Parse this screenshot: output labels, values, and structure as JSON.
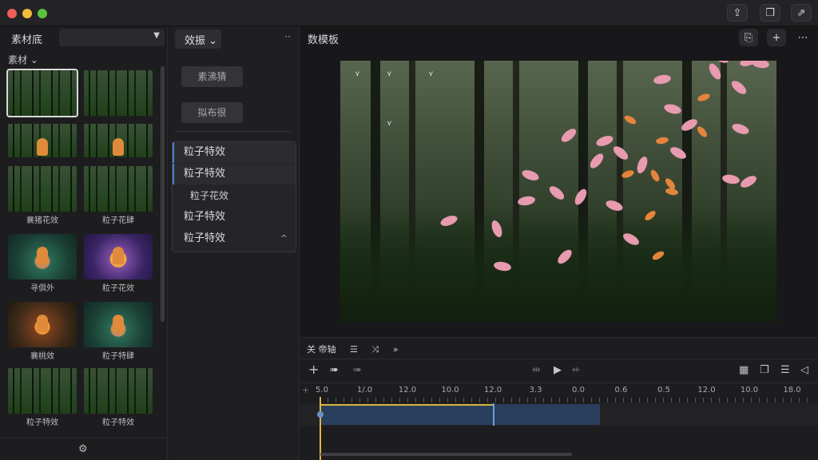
{
  "titlebar": {
    "buttons": [
      "upload-icon",
      "copy-icon",
      "share-icon"
    ]
  },
  "left_panel": {
    "title": "素材底",
    "subtitle": "素材 ⌄",
    "thumbnails": [
      {
        "label": "",
        "style": "forest",
        "selected": true
      },
      {
        "label": "",
        "style": "forest"
      },
      {
        "label": "",
        "style": "forest"
      },
      {
        "label": "",
        "style": "forest"
      },
      {
        "label": "襄猪花效",
        "style": "forest"
      },
      {
        "label": "粒子花肆",
        "style": "forest"
      },
      {
        "label": "寻俱外",
        "style": "teal"
      },
      {
        "label": "粒子花效",
        "style": "magic"
      },
      {
        "label": "襄桃效",
        "style": "warm"
      },
      {
        "label": "粒子特肆",
        "style": "teal"
      },
      {
        "label": "粒子特效",
        "style": "forest"
      },
      {
        "label": "粒子特效",
        "style": "forest"
      }
    ]
  },
  "middle_panel": {
    "tab": "效振 ⌄",
    "buttons": [
      "素沸猜",
      "拟布很"
    ],
    "menu": [
      {
        "label": "粒子特效",
        "active": true
      },
      {
        "label": "粒子特效",
        "active": true
      },
      {
        "label": "粒子花效",
        "sub": true
      },
      {
        "label": "粒子特效"
      },
      {
        "label": "粒子特效",
        "chevron": "^"
      }
    ]
  },
  "preview": {
    "title": "数模板",
    "buttons": [
      "doc-icon",
      "+",
      "⋯"
    ]
  },
  "timeline": {
    "tab": "关 帝轴",
    "ruler_labels": [
      "5.0",
      "1/.0",
      "12.0",
      "10.0",
      "12.0",
      "3.3",
      "0.0",
      "0.6",
      "0.5",
      "12.0",
      "10.0",
      "18.0"
    ],
    "colors": {
      "clip": "#2a3e5e",
      "playhead": "#e0b73c",
      "selection": "#4d7fd0"
    }
  }
}
